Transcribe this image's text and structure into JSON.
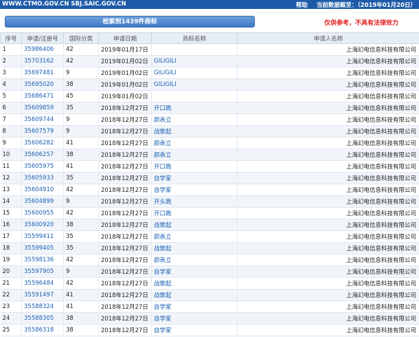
{
  "topbar": {
    "sites": "WWW.CTMO.GOV.CN SBJ.SAIC.GOV.CN",
    "help": "帮助",
    "date_label": "当前数据截至：",
    "date_value": "（2019年01月20日）"
  },
  "search_button": "检索到1439件商标",
  "disclaimer": "仅供参考，不具有法律效力",
  "table": {
    "headers": [
      "序号",
      "申请/注册号",
      "国际分类",
      "申请日期",
      "商标名称",
      "申请人名称"
    ],
    "rows": [
      {
        "no": "1",
        "reg": "35986406",
        "cls": "42",
        "date": "2019年01月17日",
        "name": "",
        "applicant": "上海幻电信息科技有限公司"
      },
      {
        "no": "2",
        "reg": "35703162",
        "cls": "42",
        "date": "2019年01月02日",
        "name": "GILIGILI",
        "applicant": "上海幻电信息科技有限公司"
      },
      {
        "no": "3",
        "reg": "35697481",
        "cls": "9",
        "date": "2019年01月02日",
        "name": "GILIGILI",
        "applicant": "上海幻电信息科技有限公司"
      },
      {
        "no": "4",
        "reg": "35695020",
        "cls": "38",
        "date": "2019年01月02日",
        "name": "GILIGILI",
        "applicant": "上海幻电信息科技有限公司"
      },
      {
        "no": "5",
        "reg": "35686471",
        "cls": "45",
        "date": "2019年01月02日",
        "name": "",
        "applicant": "上海幻电信息科技有限公司"
      },
      {
        "no": "6",
        "reg": "35609859",
        "cls": "35",
        "date": "2018年12月27日",
        "name": "开口跪",
        "applicant": "上海幻电信息科技有限公司"
      },
      {
        "no": "7",
        "reg": "35609744",
        "cls": "9",
        "date": "2018年12月27日",
        "name": "颜表立",
        "applicant": "上海幻电信息科技有限公司"
      },
      {
        "no": "8",
        "reg": "35607579",
        "cls": "9",
        "date": "2018年12月27日",
        "name": "战歌起",
        "applicant": "上海幻电信息科技有限公司"
      },
      {
        "no": "9",
        "reg": "35606282",
        "cls": "41",
        "date": "2018年12月27日",
        "name": "颜表立",
        "applicant": "上海幻电信息科技有限公司"
      },
      {
        "no": "10",
        "reg": "35606257",
        "cls": "38",
        "date": "2018年12月27日",
        "name": "颜表立",
        "applicant": "上海幻电信息科技有限公司"
      },
      {
        "no": "11",
        "reg": "35605975",
        "cls": "41",
        "date": "2018年12月27日",
        "name": "开口跪",
        "applicant": "上海幻电信息科技有限公司"
      },
      {
        "no": "12",
        "reg": "35605933",
        "cls": "35",
        "date": "2018年12月27日",
        "name": "自学家",
        "applicant": "上海幻电信息科技有限公司"
      },
      {
        "no": "13",
        "reg": "35604910",
        "cls": "42",
        "date": "2018年12月27日",
        "name": "自学家",
        "applicant": "上海幻电信息科技有限公司"
      },
      {
        "no": "14",
        "reg": "35604899",
        "cls": "9",
        "date": "2018年12月27日",
        "name": "开头跪",
        "applicant": "上海幻电信息科技有限公司"
      },
      {
        "no": "15",
        "reg": "35600955",
        "cls": "42",
        "date": "2018年12月27日",
        "name": "开口跪",
        "applicant": "上海幻电信息科技有限公司"
      },
      {
        "no": "16",
        "reg": "35600920",
        "cls": "38",
        "date": "2018年12月27日",
        "name": "战歌起",
        "applicant": "上海幻电信息科技有限公司"
      },
      {
        "no": "17",
        "reg": "35599411",
        "cls": "35",
        "date": "2018年12月27日",
        "name": "颜表立",
        "applicant": "上海幻电信息科技有限公司"
      },
      {
        "no": "18",
        "reg": "35599405",
        "cls": "35",
        "date": "2018年12月27日",
        "name": "战歌起",
        "applicant": "上海幻电信息科技有限公司"
      },
      {
        "no": "19",
        "reg": "35598136",
        "cls": "42",
        "date": "2018年12月27日",
        "name": "颜表立",
        "applicant": "上海幻电信息科技有限公司"
      },
      {
        "no": "20",
        "reg": "35597905",
        "cls": "9",
        "date": "2018年12月27日",
        "name": "自学家",
        "applicant": "上海幻电信息科技有限公司"
      },
      {
        "no": "21",
        "reg": "35596484",
        "cls": "42",
        "date": "2018年12月27日",
        "name": "战歌起",
        "applicant": "上海幻电信息科技有限公司"
      },
      {
        "no": "22",
        "reg": "35591497",
        "cls": "41",
        "date": "2018年12月27日",
        "name": "战歌起",
        "applicant": "上海幻电信息科技有限公司"
      },
      {
        "no": "23",
        "reg": "35588324",
        "cls": "41",
        "date": "2018年12月27日",
        "name": "自学家",
        "applicant": "上海幻电信息科技有限公司"
      },
      {
        "no": "24",
        "reg": "35588305",
        "cls": "38",
        "date": "2018年12月27日",
        "name": "自学家",
        "applicant": "上海幻电信息科技有限公司"
      },
      {
        "no": "25",
        "reg": "35586318",
        "cls": "38",
        "date": "2018年12月27日",
        "name": "自学家",
        "applicant": "上海幻电信息科技有限公司"
      }
    ]
  }
}
